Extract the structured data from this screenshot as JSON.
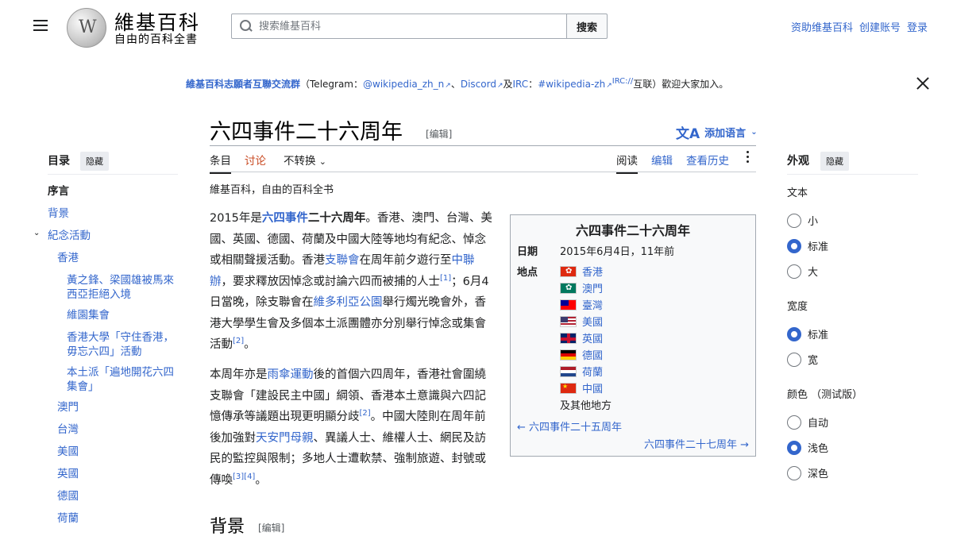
{
  "header": {
    "menu_icon": "hamburger-menu-icon",
    "logo_icon": "wikipedia-globe-icon",
    "logo_title": "維基百科",
    "logo_tagline": "自由的百科全書",
    "search_placeholder": "搜索維基百科",
    "search_button": "搜索",
    "user_links": [
      "资助维基百科",
      "创建账号",
      "登录"
    ]
  },
  "banner": {
    "link_text": "維基百科志願者互聯交流群",
    "t1": "（Telegram：",
    "telegram": "@wikipedia_zh_n",
    "t2": "、",
    "discord": "Discord",
    "t3": "及",
    "irc": "IRC",
    "t4": "：",
    "irc_channel": "#wikipedia-zh",
    "irc_prefix": "IRC://",
    "t5": "互联）歡迎大家加入。",
    "close_icon": "close-icon"
  },
  "title": {
    "text": "六四事件二十六周年",
    "edit": "[编辑]",
    "lang_icon": "translate-icon",
    "lang_button": "添加语言"
  },
  "tabs": {
    "article": "条目",
    "talk": "讨论",
    "variant": "不转换",
    "read": "阅读",
    "edit": "编辑",
    "history": "查看历史",
    "more_icon": "more-vertical-icon"
  },
  "from_wiki": "維基百科，自由的百科全书",
  "para1": {
    "a": "2015年是",
    "l1": "六四事件",
    "b1": "二十六周年",
    "b": "。香港、澳門、台灣、美國、英國、德國、荷蘭及中國大陸等地均有紀念、悼念或相關聲援活動。香港",
    "l2": "支聯會",
    "c": "在周年前夕遊行至",
    "l3": "中聯辦",
    "d": "，要求釋放因悼念或討論六四而被捕的人士",
    "r1": "[1]",
    "e": "；6月4日當晚，除支聯會在",
    "l4": "維多利亞公園",
    "f": "舉行燭光晚會外，香港大學學生會及多個本土派團體亦分別舉行悼念或集會活動",
    "r2": "[2]",
    "g": "。"
  },
  "para2": {
    "a": "本周年亦是",
    "l1": "雨傘運動",
    "b": "後的首個六四周年，香港社會圍繞支聯會「建設民主中國」綱領、香港本土意識與六四記憶傳承等議題出現更明顯分歧",
    "r1": "[2]",
    "c": "。中國大陸則在周年前後加強對",
    "l2": "天安門母親",
    "d": "、異議人士、維權人士、網民及訪民的監控與限制；多地人士遭軟禁、強制旅遊、封號或傳喚",
    "r2": "[3]",
    "r3": "[4]",
    "e": "。"
  },
  "section_heading": "背景",
  "section_edit": "[编辑]",
  "infobox": {
    "title": "六四事件二十六周年",
    "date_label": "日期",
    "date_value": "2015年6月4日，11年前",
    "place_label": "地点",
    "places": [
      "香港",
      "澳門",
      "臺灣",
      "美國",
      "英國",
      "德國",
      "荷蘭",
      "中國"
    ],
    "other": "及其他地方",
    "prev": "← 六四事件二十五周年",
    "next": "六四事件二十七周年 →"
  },
  "toc": {
    "heading": "目录",
    "hide": "隐藏",
    "chevron_icon": "chevron-down-icon",
    "items": [
      {
        "label": "序言",
        "level": 0
      },
      {
        "label": "背景",
        "level": 0
      },
      {
        "label": "紀念活動",
        "level": 0
      },
      {
        "label": "香港",
        "level": 1
      },
      {
        "label": "黃之鋒、梁國雄被馬來西亞拒絕入境",
        "level": 2
      },
      {
        "label": "維園集會",
        "level": 2
      },
      {
        "label": "香港大學「守住香港，毋忘六四」活動",
        "level": 2
      },
      {
        "label": "本土派「遍地開花六四集會」",
        "level": 2
      },
      {
        "label": "澳門",
        "level": 1
      },
      {
        "label": "台灣",
        "level": 1
      },
      {
        "label": "美國",
        "level": 1
      },
      {
        "label": "英國",
        "level": 1
      },
      {
        "label": "德國",
        "level": 1
      },
      {
        "label": "荷蘭",
        "level": 1
      }
    ]
  },
  "appearance": {
    "heading": "外观",
    "hide": "隐藏",
    "text_label": "文本",
    "text_options": [
      "小",
      "标准",
      "大"
    ],
    "text_selected": "标准",
    "width_label": "宽度",
    "width_options": [
      "标准",
      "宽"
    ],
    "width_selected": "标准",
    "color_label": "颜色 （测试版）",
    "color_options": [
      "自动",
      "浅色",
      "深色"
    ],
    "color_selected": "浅色"
  },
  "colors": {
    "link": "#3366cc",
    "talk_tab": "#c94a22",
    "radio_on": "#3366cc"
  }
}
